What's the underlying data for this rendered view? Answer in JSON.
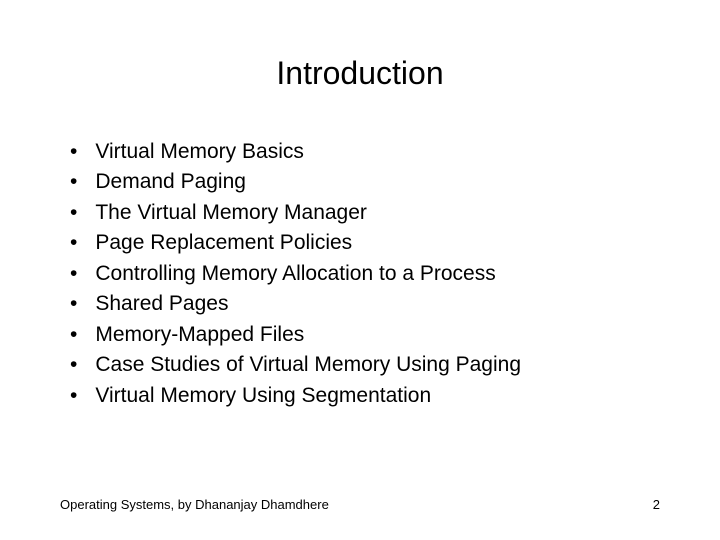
{
  "title": "Introduction",
  "bullets": [
    "Virtual Memory Basics",
    "Demand Paging",
    "The Virtual Memory Manager",
    "Page Replacement Policies",
    "Controlling Memory Allocation to a Process",
    "Shared Pages",
    "Memory-Mapped Files",
    "Case Studies of Virtual Memory Using Paging",
    "Virtual Memory Using Segmentation"
  ],
  "footer": {
    "text": "Operating Systems, by Dhananjay Dhamdhere",
    "page": "2"
  }
}
